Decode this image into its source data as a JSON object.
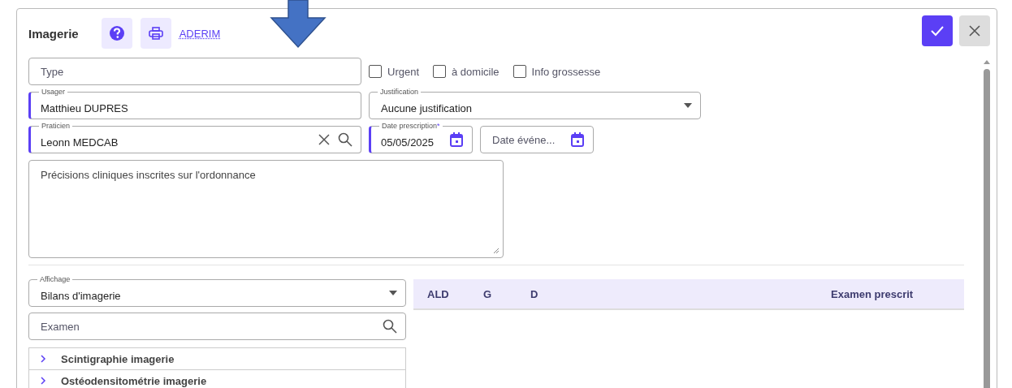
{
  "dialog": {
    "title": "Imagerie",
    "link": "ADERIM"
  },
  "type_field": {
    "placeholder": "Type"
  },
  "checkboxes": [
    {
      "label": "Urgent",
      "checked": false
    },
    {
      "label": "à domicile",
      "checked": false
    },
    {
      "label": "Info grossesse",
      "checked": false
    }
  ],
  "usager": {
    "label": "Usager",
    "value": "Matthieu DUPRES",
    "required": true
  },
  "justification": {
    "label": "Justification",
    "value": "Aucune justification",
    "required": false
  },
  "praticien": {
    "label": "Praticien",
    "value": "Leonn MEDCAB",
    "required": true
  },
  "date_prescription": {
    "label": "Date prescription",
    "asterisk": "*",
    "value": "05/05/2025",
    "required": true
  },
  "date_evenement": {
    "placeholder": "Date événe...",
    "required": false
  },
  "precisions": {
    "placeholder": "Précisions cliniques inscrites sur l'ordonnance"
  },
  "affichage": {
    "label": "Affichage",
    "value": "Bilans d'imagerie"
  },
  "examen_search": {
    "placeholder": "Examen"
  },
  "exam_groups": [
    {
      "label": "Scintigraphie imagerie",
      "expanded": false
    },
    {
      "label": "Ostéodensitométrie imagerie",
      "expanded": false
    }
  ],
  "table": {
    "columns": [
      "ALD",
      "G",
      "D",
      "Examen prescrit"
    ]
  }
}
